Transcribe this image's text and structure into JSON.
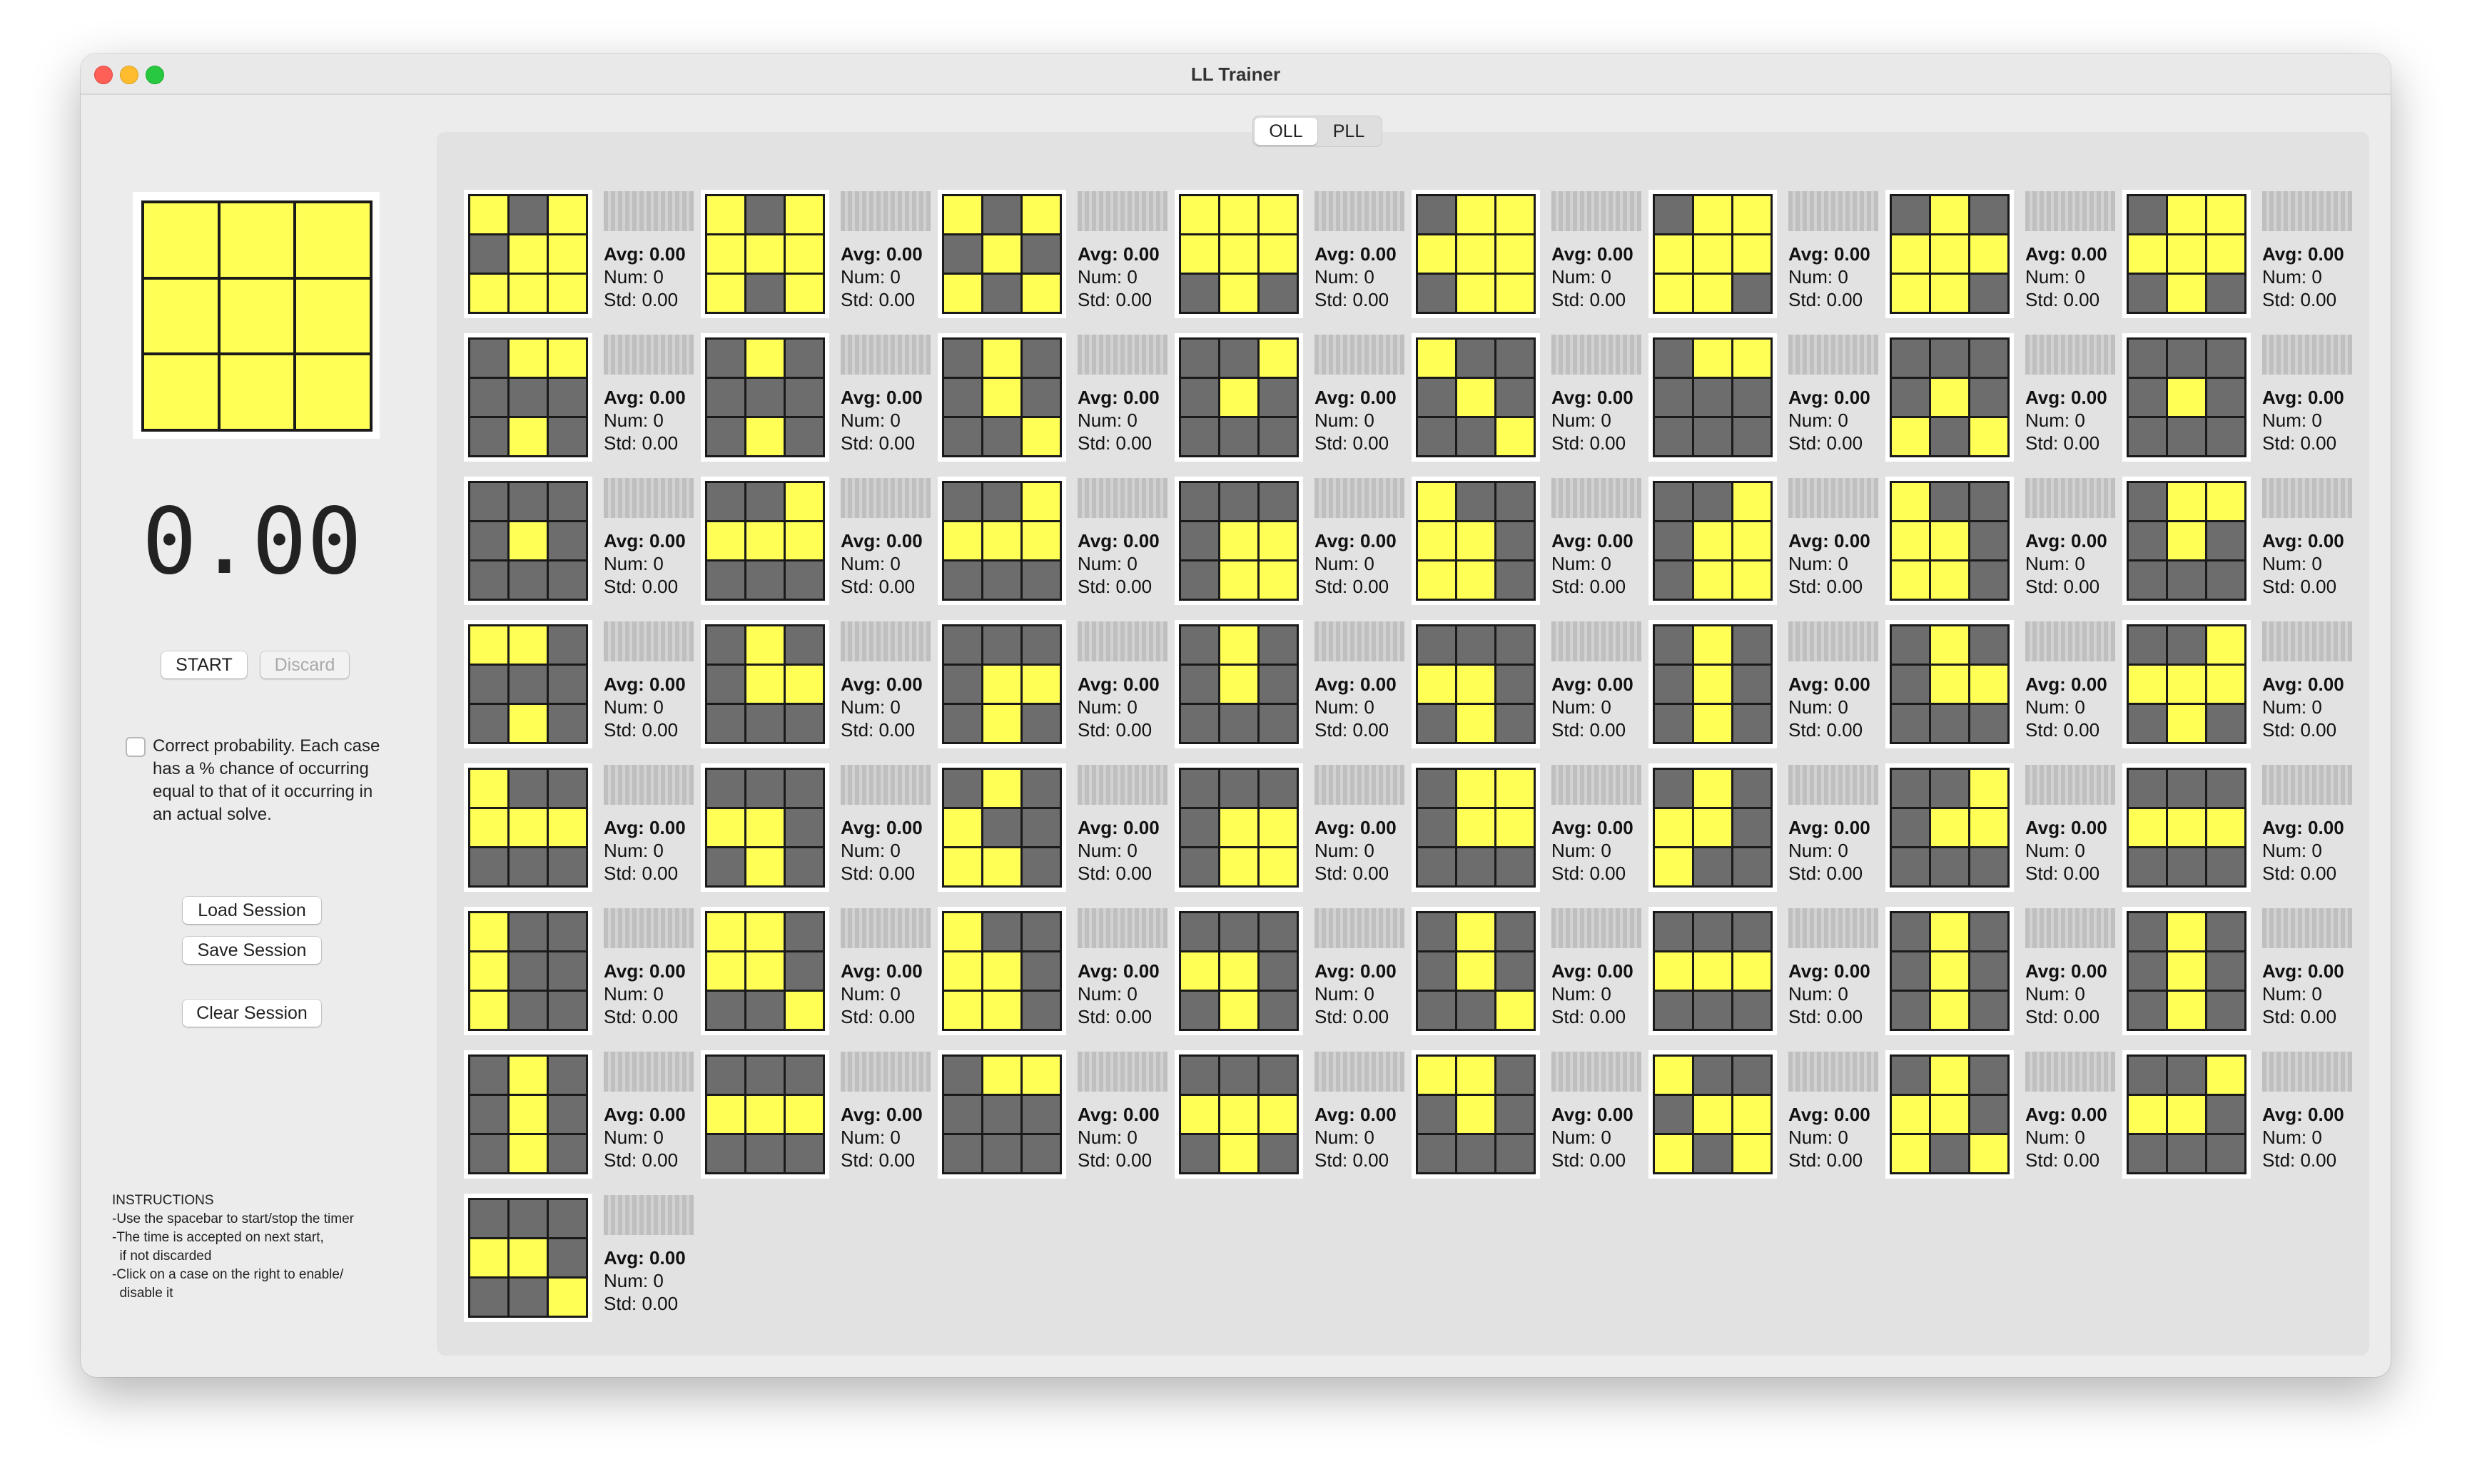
{
  "window": {
    "title": "LL Trainer"
  },
  "tabs": [
    {
      "label": "OLL",
      "active": true
    },
    {
      "label": "PLL",
      "active": false
    }
  ],
  "preview": {
    "pattern": "YYYYYYYYY"
  },
  "timer": {
    "value": "0.00"
  },
  "controls": {
    "start_label": "START",
    "discard_label": "Discard",
    "probability_checked": false,
    "probability_text": "Correct probability. Each case has a % chance of occurring equal to that of it occurring in an actual solve.",
    "load_label": "Load Session",
    "save_label": "Save Session",
    "clear_label": "Clear Session"
  },
  "instructions": {
    "heading": "INSTRUCTIONS",
    "lines": [
      "-Use the spacebar to start/stop the timer",
      "-The time is accepted on next start,",
      "  if not discarded",
      "-Click on a case on the right to enable/",
      "  disable it"
    ]
  },
  "colors": {
    "yellow": "#ffff55",
    "gray": "#6d6d6d"
  },
  "stat_labels": {
    "avg": "Avg:",
    "num": "Num:",
    "std": "Std:"
  },
  "cases": [
    {
      "pattern": "YGYGYYYYY",
      "avg": "0.00",
      "num": "0",
      "std": "0.00"
    },
    {
      "pattern": "YGYYYYYGY",
      "avg": "0.00",
      "num": "0",
      "std": "0.00"
    },
    {
      "pattern": "YGYGYGYGY",
      "avg": "0.00",
      "num": "0",
      "std": "0.00"
    },
    {
      "pattern": "YYYYYYGYG",
      "avg": "0.00",
      "num": "0",
      "std": "0.00"
    },
    {
      "pattern": "GYYYYYGYY",
      "avg": "0.00",
      "num": "0",
      "std": "0.00"
    },
    {
      "pattern": "GYYYYYYYG",
      "avg": "0.00",
      "num": "0",
      "std": "0.00"
    },
    {
      "pattern": "GYGYYYYYG",
      "avg": "0.00",
      "num": "0",
      "std": "0.00"
    },
    {
      "pattern": "GYYYYYGYG",
      "avg": "0.00",
      "num": "0",
      "std": "0.00"
    },
    {
      "pattern": "GYYGGGGYG",
      "avg": "0.00",
      "num": "0",
      "std": "0.00"
    },
    {
      "pattern": "GYGGGGGYG",
      "avg": "0.00",
      "num": "0",
      "std": "0.00"
    },
    {
      "pattern": "GYGGYGGGY",
      "avg": "0.00",
      "num": "0",
      "std": "0.00"
    },
    {
      "pattern": "GGYGYGGGG",
      "avg": "0.00",
      "num": "0",
      "std": "0.00"
    },
    {
      "pattern": "YGGGYGGGY",
      "avg": "0.00",
      "num": "0",
      "std": "0.00"
    },
    {
      "pattern": "GYYGGGGGG",
      "avg": "0.00",
      "num": "0",
      "std": "0.00"
    },
    {
      "pattern": "GGGGYGYGY",
      "avg": "0.00",
      "num": "0",
      "std": "0.00"
    },
    {
      "pattern": "GGGGYGGGG",
      "avg": "0.00",
      "num": "0",
      "std": "0.00"
    },
    {
      "pattern": "GGGGYGGGG",
      "avg": "0.00",
      "num": "0",
      "std": "0.00"
    },
    {
      "pattern": "GGYYYYGGG",
      "avg": "0.00",
      "num": "0",
      "std": "0.00"
    },
    {
      "pattern": "GGYYYYGGG",
      "avg": "0.00",
      "num": "0",
      "std": "0.00"
    },
    {
      "pattern": "GGGGYYGYY",
      "avg": "0.00",
      "num": "0",
      "std": "0.00"
    },
    {
      "pattern": "YGGYYGYYG",
      "avg": "0.00",
      "num": "0",
      "std": "0.00"
    },
    {
      "pattern": "GGYGYYGYY",
      "avg": "0.00",
      "num": "0",
      "std": "0.00"
    },
    {
      "pattern": "YGGYYGYYG",
      "avg": "0.00",
      "num": "0",
      "std": "0.00"
    },
    {
      "pattern": "GYYGYGGGG",
      "avg": "0.00",
      "num": "0",
      "std": "0.00"
    },
    {
      "pattern": "YYGGGGGYG",
      "avg": "0.00",
      "num": "0",
      "std": "0.00"
    },
    {
      "pattern": "GYGGYYGGG",
      "avg": "0.00",
      "num": "0",
      "std": "0.00"
    },
    {
      "pattern": "GGGGYYGYG",
      "avg": "0.00",
      "num": "0",
      "std": "0.00"
    },
    {
      "pattern": "GYGGYGGGG",
      "avg": "0.00",
      "num": "0",
      "std": "0.00"
    },
    {
      "pattern": "GGGYYGGYG",
      "avg": "0.00",
      "num": "0",
      "std": "0.00"
    },
    {
      "pattern": "GYGGYGGYG",
      "avg": "0.00",
      "num": "0",
      "std": "0.00"
    },
    {
      "pattern": "GYGGYYGGG",
      "avg": "0.00",
      "num": "0",
      "std": "0.00"
    },
    {
      "pattern": "GGYYYYGYG",
      "avg": "0.00",
      "num": "0",
      "std": "0.00"
    },
    {
      "pattern": "YGGYYYGGG",
      "avg": "0.00",
      "num": "0",
      "std": "0.00"
    },
    {
      "pattern": "GGGYYGGYG",
      "avg": "0.00",
      "num": "0",
      "std": "0.00"
    },
    {
      "pattern": "GYGYGGYYG",
      "avg": "0.00",
      "num": "0",
      "std": "0.00"
    },
    {
      "pattern": "GGGGYYGYY",
      "avg": "0.00",
      "num": "0",
      "std": "0.00"
    },
    {
      "pattern": "GYYGYYGGG",
      "avg": "0.00",
      "num": "0",
      "std": "0.00"
    },
    {
      "pattern": "GYGYYGYGG",
      "avg": "0.00",
      "num": "0",
      "std": "0.00"
    },
    {
      "pattern": "GGYGYYGGG",
      "avg": "0.00",
      "num": "0",
      "std": "0.00"
    },
    {
      "pattern": "GGGYYYGGG",
      "avg": "0.00",
      "num": "0",
      "std": "0.00"
    },
    {
      "pattern": "YGGYGGYGG",
      "avg": "0.00",
      "num": "0",
      "std": "0.00"
    },
    {
      "pattern": "YYGYYGGGY",
      "avg": "0.00",
      "num": "0",
      "std": "0.00"
    },
    {
      "pattern": "YGGYYGYYG",
      "avg": "0.00",
      "num": "0",
      "std": "0.00"
    },
    {
      "pattern": "GGGYYGGYG",
      "avg": "0.00",
      "num": "0",
      "std": "0.00"
    },
    {
      "pattern": "GYGGYGGGY",
      "avg": "0.00",
      "num": "0",
      "std": "0.00"
    },
    {
      "pattern": "GGGYYYGGG",
      "avg": "0.00",
      "num": "0",
      "std": "0.00"
    },
    {
      "pattern": "GYGGYGGYG",
      "avg": "0.00",
      "num": "0",
      "std": "0.00"
    },
    {
      "pattern": "GYGGYGGYG",
      "avg": "0.00",
      "num": "0",
      "std": "0.00"
    },
    {
      "pattern": "GYGGYGGYG",
      "avg": "0.00",
      "num": "0",
      "std": "0.00"
    },
    {
      "pattern": "GGGYYYGGG",
      "avg": "0.00",
      "num": "0",
      "std": "0.00"
    },
    {
      "pattern": "GYYGGGGGG",
      "avg": "0.00",
      "num": "0",
      "std": "0.00"
    },
    {
      "pattern": "GGGYYYGYG",
      "avg": "0.00",
      "num": "0",
      "std": "0.00"
    },
    {
      "pattern": "YYGGYGGGG",
      "avg": "0.00",
      "num": "0",
      "std": "0.00"
    },
    {
      "pattern": "YGGGYYYGY",
      "avg": "0.00",
      "num": "0",
      "std": "0.00"
    },
    {
      "pattern": "GYGYYGYGY",
      "avg": "0.00",
      "num": "0",
      "std": "0.00"
    },
    {
      "pattern": "GGYYYGGGG",
      "avg": "0.00",
      "num": "0",
      "std": "0.00"
    },
    {
      "pattern": "GGGYYGGGY",
      "avg": "0.00",
      "num": "0",
      "std": "0.00"
    }
  ]
}
